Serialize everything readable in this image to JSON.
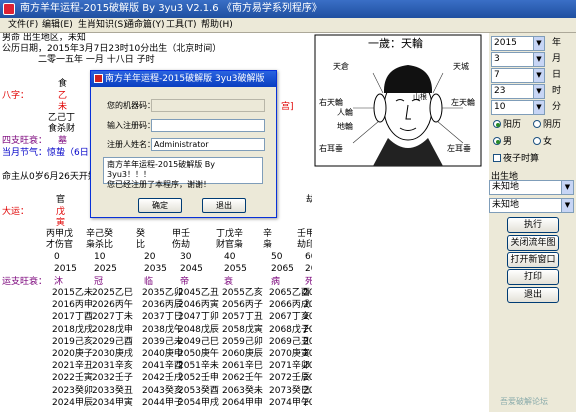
{
  "window": {
    "title": "南方羊年运程-2015破解版 By 3yu3  V2.1.6  《南方易学系列程序》"
  },
  "menu": [
    "文件(F)",
    "编辑(E)",
    "生肖知识(S)",
    "通命篇(Y)",
    "工具(T)",
    "帮助(H)"
  ],
  "info": {
    "line1": "男命    出生地区，未知",
    "line2": "公历日期，2015年3月7日23时10分出生（北京时间）",
    "line3": "二零一五年          一月              十八日              子时",
    "bazi_label": "八字：",
    "bazi_cut": "宫]",
    "wangshuai_label": "四支旺衰：",
    "jieqi": "当月节气：惊蛰（6日",
    "qiyun": "命主从0岁6月26天开始",
    "dayun_label": "大运：",
    "liunian_label": "运支旺衰："
  },
  "bazi": {
    "top": "食",
    "gan": "乙",
    "zhi": "未",
    "cang": [
      "乙己丁",
      "食杀财"
    ],
    "wangshuai": "墓"
  },
  "dayun": {
    "gan": [
      "官",
      "戊",
      "寅"
    ],
    "hidden": [
      "丙甲戊",
      "辛己癸",
      "癸",
      "甲壬",
      "丁戊辛",
      "辛",
      "壬甲",
      "乙己丁"
    ],
    "shishen": [
      "才伤官",
      "枭杀比",
      "比",
      "伤劫",
      "财官枭",
      "枭",
      "劫印官",
      "食杀财"
    ],
    "ages": [
      "0",
      "10",
      "20",
      "30",
      "40",
      "50",
      "60",
      "70"
    ],
    "years": [
      "2015",
      "2025",
      "2035",
      "2045",
      "2055",
      "2065",
      "2075",
      "2085"
    ],
    "states": [
      "沐",
      "冠",
      "临",
      "帝",
      "衰",
      "病",
      "死",
      "墓"
    ],
    "right_col": [
      "劫",
      "壬",
      "申",
      "辛",
      "未",
      "乙己丁"
    ]
  },
  "liunian": [
    [
      "2015乙未",
      "2025乙巳",
      "2035乙卯",
      "2045乙丑",
      "2055乙亥",
      "2065乙酉",
      "2075乙未",
      "2085乙巳"
    ],
    [
      "2016丙申",
      "2026丙午",
      "2036丙辰",
      "2046丙寅",
      "2056丙子",
      "2066丙戌",
      "2076丙申",
      "2086丙午"
    ],
    [
      "2017丁酉",
      "2027丁未",
      "2037丁巳",
      "2047丁卯",
      "2057丁丑",
      "2067丁亥",
      "2077丁酉",
      "2087丁未"
    ],
    [
      "2018戊戌",
      "2028戊申",
      "2038戊午",
      "2048戊辰",
      "2058戊寅",
      "2068戊子",
      "2078戊戌",
      "2088戊申"
    ],
    [
      "2019己亥",
      "2029己酉",
      "2039己未",
      "2049己巳",
      "2059己卯",
      "2069己丑",
      "2079己亥",
      "2089己酉"
    ],
    [
      "2020庚子",
      "2030庚戌",
      "2040庚申",
      "2050庚午",
      "2060庚辰",
      "2070庚寅",
      "2080庚子",
      "2090庚戌"
    ],
    [
      "2021辛丑",
      "2031辛亥",
      "2041辛酉",
      "2051辛未",
      "2061辛巳",
      "2071辛卯",
      "2081辛丑",
      "2091辛亥"
    ],
    [
      "2022壬寅",
      "2032壬子",
      "2042壬戌",
      "2052壬申",
      "2062壬午",
      "2072壬辰",
      "2082壬寅",
      "2092壬子"
    ],
    [
      "2023癸卯",
      "2033癸丑",
      "2043癸亥",
      "2053癸酉",
      "2063癸未",
      "2073癸巳",
      "2083癸卯",
      "2093癸丑"
    ],
    [
      "2024甲辰",
      "2034甲寅",
      "2044甲子",
      "2054甲戌",
      "2064甲申",
      "2074甲午",
      "2084甲辰",
      "2094甲寅"
    ]
  ],
  "face": {
    "title": "一歲：天輪",
    "labels": [
      "天倉",
      "天城",
      "右天輪",
      "左天輪",
      "人輪",
      "山根",
      "地輪",
      "右耳垂",
      "左耳垂"
    ]
  },
  "panel": {
    "year": "2015",
    "year_unit": "年",
    "month": "3",
    "month_unit": "月",
    "day": "7",
    "day_unit": "日",
    "hour": "23",
    "hour_unit": "时",
    "minute": "10",
    "minute_unit": "分",
    "cal_solar": "阳历",
    "cal_lunar": "阴历",
    "male": "男",
    "female": "女",
    "night_zi": "夜子时算",
    "birthplace_label": "出生地",
    "place1": "未知地",
    "place2": "未知地",
    "btn_run": "执行",
    "btn_close_report": "关闭流年图",
    "btn_open_window": "打开新窗口",
    "btn_print": "打印",
    "btn_exit": "退出"
  },
  "dialog": {
    "title": "南方羊年运程-2015破解版  3yu3破解版",
    "machine_label": "您的机器码：",
    "code_label": "输入注册码：",
    "name_label": "注册人姓名：",
    "name_value": "Administrator",
    "message_line1": "南方羊年运程-2015破解版 By 3yu3！！！",
    "message_line2": "您已经注册了本程序，谢谢！",
    "ok": "确定",
    "exit": "退出"
  },
  "watermark": "吾爱破解论坛"
}
